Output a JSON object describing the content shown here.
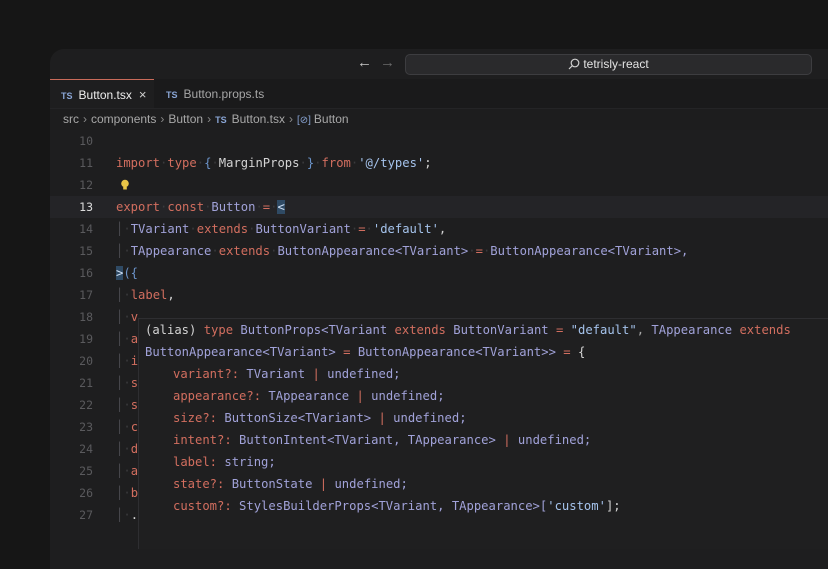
{
  "titlebar": {
    "back_icon": "arrow-left-icon",
    "forward_icon": "arrow-right-icon",
    "search_text": "tetrisly-react",
    "search_icon": "search-icon"
  },
  "tabs": [
    {
      "badge": "TS",
      "label": "Button.tsx",
      "active": true,
      "close": "×"
    },
    {
      "badge": "TS",
      "label": "Button.props.ts",
      "active": false
    }
  ],
  "breadcrumb": {
    "items": [
      "src",
      "components",
      "Button"
    ],
    "file_badge": "TS",
    "file": "Button.tsx",
    "symbol_icon": "[⊘]",
    "symbol": "Button"
  },
  "editor": {
    "line_numbers": [
      "10",
      "11",
      "12",
      "13",
      "14",
      "15",
      "16",
      "17",
      "18",
      "19",
      "20",
      "21",
      "22",
      "23",
      "24",
      "25",
      "26",
      "27"
    ],
    "current_line": "13",
    "lines": {
      "l11": {
        "t1": "import",
        "t2": "type",
        "t3": "{",
        "t4": "MarginProps",
        "t5": "}",
        "t6": "from",
        "t7": "'@/types'",
        "t8": ";"
      },
      "l13": {
        "t1": "export",
        "t2": "const",
        "t3": "Button",
        "t4": "=",
        "t5": "<"
      },
      "l14": {
        "t1": "TVariant",
        "t2": "extends",
        "t3": "ButtonVariant",
        "t4": "=",
        "t5": "'default'",
        "t6": ","
      },
      "l15": {
        "t1": "TAppearance",
        "t2": "extends",
        "t3": "ButtonAppearance<TVariant>",
        "t4": "=",
        "t5": "ButtonAppearance<TVariant>,"
      },
      "l16": {
        "t1": ">",
        "t2": "({"
      },
      "l17": {
        "t1": "label",
        "t2": ","
      },
      "l18": {
        "t1": "v"
      },
      "l19": {
        "t1": "a"
      },
      "l20": {
        "t1": "i"
      },
      "l21": {
        "t1": "s"
      },
      "l22": {
        "t1": "s"
      },
      "l23": {
        "t1": "c"
      },
      "l24": {
        "t1": "d"
      },
      "l25": {
        "t1": "a"
      },
      "l26": {
        "t1": "b"
      },
      "l27": {
        "t1": "."
      }
    }
  },
  "hover": {
    "line1": {
      "a": "(alias)",
      "b": "type",
      "c": "ButtonProps<TVariant",
      "d": "extends",
      "e": "ButtonVariant",
      "f": "=",
      "g": "\"default\"",
      "h": ",",
      "i": "TAppearance",
      "j": "extends"
    },
    "line2": {
      "a": "ButtonAppearance<TVariant>",
      "b": "=",
      "c": "ButtonAppearance<TVariant>>",
      "d": "=",
      "e": "{"
    },
    "props": [
      {
        "name": "variant?:",
        "type": "TVariant",
        "sep": "|",
        "rest": "undefined;"
      },
      {
        "name": "appearance?:",
        "type": "TAppearance",
        "sep": "|",
        "rest": "undefined;"
      },
      {
        "name": "size?:",
        "type": "ButtonSize<TVariant>",
        "sep": "|",
        "rest": "undefined;"
      },
      {
        "name": "intent?:",
        "type": "ButtonIntent<TVariant, TAppearance>",
        "sep": "|",
        "rest": "undefined;"
      },
      {
        "name": "label:",
        "type": "string;",
        "sep": "",
        "rest": ""
      },
      {
        "name": "state?:",
        "type": "ButtonState",
        "sep": "|",
        "rest": "undefined;"
      },
      {
        "name": "custom?:",
        "type": "StylesBuilderProps<TVariant, TAppearance>[",
        "sep": "'custom'",
        "rest": "];"
      }
    ]
  }
}
